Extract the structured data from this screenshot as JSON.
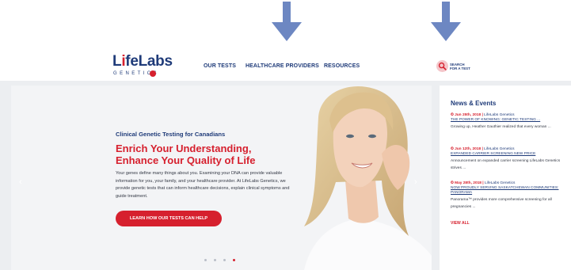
{
  "header": {
    "logo": {
      "brand": "LifeLabs",
      "sub": "GENETICS"
    },
    "nav": [
      {
        "label": "OUR TESTS"
      },
      {
        "label": "HEALTHCARE PROVIDERS"
      },
      {
        "label": "RESOURCES"
      }
    ],
    "search_test": {
      "line1": "SEARCH",
      "line2": "FOR A TEST",
      "icon": "magnifier-icon"
    }
  },
  "annotations": {
    "arrow_icon": "down-arrow-icon",
    "color": "#6d87c2"
  },
  "hero": {
    "kicker": "Clinical Genetic Testing for Canadians",
    "title_line1": "Enrich Your Understanding,",
    "title_line2": "Enhance Your Quality of Life",
    "body": "Your genes define many things about you. Examining your DNA can provide valuable information for you, your family, and your healthcare provider. At LifeLabs Genetics, we provide genetic tests that can inform healthcare decisions, explain clinical symptoms and guide treatment.",
    "cta": "LEARN HOW OUR TESTS CAN HELP",
    "prev_icon": "chevron-left-icon",
    "next_icon": "chevron-right-icon",
    "slides": 4,
    "active_slide": 4
  },
  "news": {
    "title": "News & Events",
    "items": [
      {
        "date": "Jun 25th, 2018",
        "source": "LifeLabs Genetics",
        "link": "THE POWER OF KNOWING: GENETIC TESTING ...",
        "desc": "Growing up, Heather Gauthier realized that every woman ..."
      },
      {
        "date": "Jun 12th, 2018",
        "source": "LifeLabs Genetics",
        "link": "EXPANDED CARRIER SCREENING NEW PRICE",
        "desc": "Announcement on expanded carrier screening LifeLabs Genetics strives ..."
      },
      {
        "date": "May 28th, 2018",
        "source": "LifeLabs Genetics",
        "link": "NOW PROUDLY SERVING SASKATCHEWAN COMMUNITIES: PANORAMA",
        "desc": "Panorama™ provides more comprehensive screening for all pregnancies ..."
      }
    ],
    "view_all": "VIEW ALL"
  },
  "colors": {
    "brand_blue": "#1f3b79",
    "brand_red": "#d6202e",
    "background": "#eceef1"
  }
}
